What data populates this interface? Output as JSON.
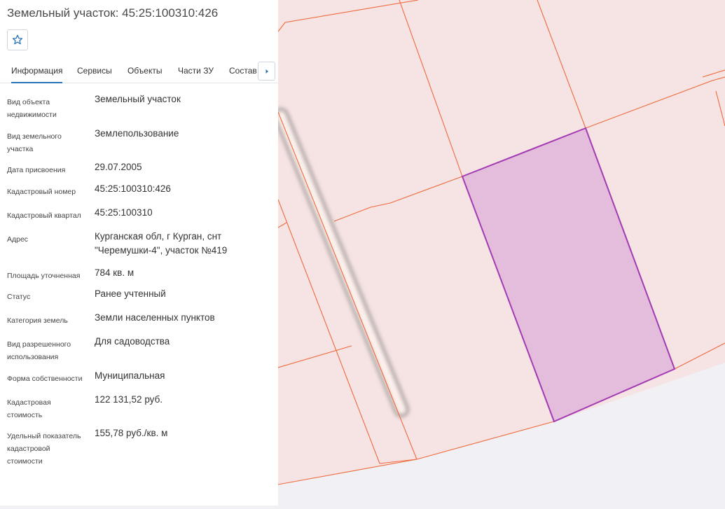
{
  "title": "Земельный участок: 45:25:100310:426",
  "favorite_icon": "star-icon",
  "tabs": [
    {
      "label": "Информация",
      "active": true
    },
    {
      "label": "Сервисы"
    },
    {
      "label": "Объекты"
    },
    {
      "label": "Части ЗУ"
    },
    {
      "label": "Состав"
    }
  ],
  "tab_next_icon": "chevron-right-icon",
  "fields": [
    {
      "label": "Вид объекта недвижимости",
      "value": "Земельный участок"
    },
    {
      "label": "Вид земельного участка",
      "value": "Землепользование"
    },
    {
      "label": "Дата присвоения",
      "value": "29.07.2005"
    },
    {
      "label": "Кадастровый номер",
      "value": "45:25:100310:426"
    },
    {
      "label": "Кадастровый квартал",
      "value": "45:25:100310"
    },
    {
      "label": "Адрес",
      "value": "Курганская обл, г Курган, снт \"Черемушки-4\", участок №419"
    },
    {
      "label": "Площадь уточненная",
      "value": "784 кв. м"
    },
    {
      "label": "Статус",
      "value": "Ранее учтенный"
    },
    {
      "label": "Категория земель",
      "value": "Земли населенных пунктов"
    },
    {
      "label": "Вид разрешенного использования",
      "value": "Для садоводства"
    },
    {
      "label": "Форма собственности",
      "value": "Муниципальная"
    },
    {
      "label": "Кадастровая стоимость",
      "value": "122 131,52 руб."
    },
    {
      "label": "Удельный показатель кадастровой стоимости",
      "value": "155,78 руб./кв. м"
    }
  ],
  "colors": {
    "parcel_fill": "#f6e3e3",
    "parcel_border": "#ee6a3c",
    "selected_fill": "#e4bcdc",
    "selected_border": "#a33bb3",
    "tab_active": "#2b73b6",
    "icon_blue": "#2b73b6"
  }
}
